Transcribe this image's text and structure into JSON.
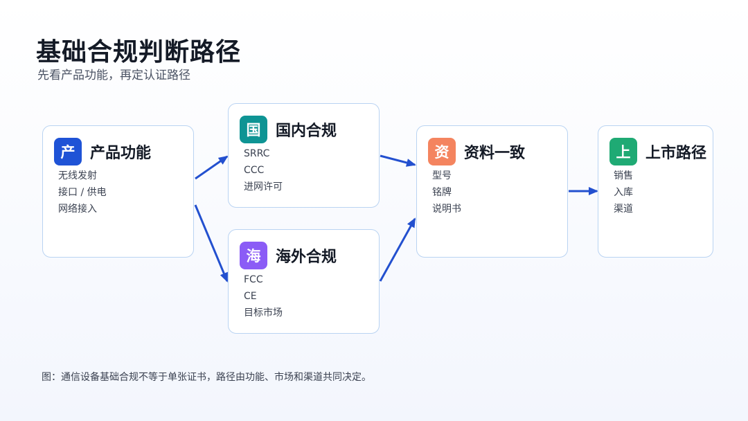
{
  "header": {
    "title": "基础合规判断路径",
    "subtitle": "先看产品功能，再定认证路径"
  },
  "nodes": {
    "product": {
      "badge": "产",
      "badge_color": "#1f53d6",
      "title": "产品功能",
      "items": [
        "无线发射",
        "接口 / 供电",
        "网络接入"
      ]
    },
    "domestic": {
      "badge": "国",
      "badge_color": "#0e9494",
      "title": "国内合规",
      "items": [
        "SRRC",
        "CCC",
        "进网许可"
      ]
    },
    "overseas": {
      "badge": "海",
      "badge_color": "#8b5cf6",
      "title": "海外合规",
      "items": [
        "FCC",
        "CE",
        "目标市场"
      ]
    },
    "docs": {
      "badge": "资",
      "badge_color": "#f4845f",
      "title": "资料一致",
      "items": [
        "型号",
        "铭牌",
        "说明书"
      ]
    },
    "launch": {
      "badge": "上",
      "badge_color": "#1faa74",
      "title": "上市路径",
      "items": [
        "销售",
        "入库",
        "渠道"
      ]
    }
  },
  "colors": {
    "arrow": "#2350cf",
    "card_border": "#b9d3f2"
  },
  "caption": "图：通信设备基础合规不等于单张证书，路径由功能、市场和渠道共同决定。"
}
